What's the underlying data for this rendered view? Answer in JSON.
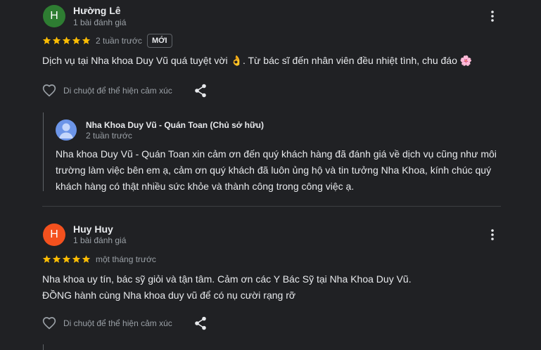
{
  "reviews": [
    {
      "avatar_letter": "H",
      "avatar_color": "#2e7d32",
      "name": "Hường Lê",
      "meta": "1 bài đánh giá",
      "rating": 5,
      "time": "2 tuần trước",
      "badge": "MỚI",
      "text": "Dịch vụ tại Nha khoa Duy Vũ quá tuyệt vời 👌. Từ bác sĩ đến nhân viên đều nhiệt tình, chu đáo 🌸",
      "like_hint": "Di chuột để thể hiện cảm xúc",
      "icons": [
        "more-vert-icon",
        "heart-outline-icon",
        "share-icon"
      ],
      "reply": {
        "owner_name": "Nha Khoa Duy Vũ - Quán Toan (Chủ sở hữu)",
        "time": "2 tuần trước",
        "lines": [
          "Nha khoa Duy Vũ - Quán Toan xin cảm ơn đến quý khách hàng đã đánh giá về dịch vụ cũng như môi",
          "trường làm việc bên em ạ, cảm ơn quý khách đã luôn ủng hộ và tin tưởng Nha Khoa, kính chúc quý",
          "khách hàng có thật nhiều sức khỏe và thành công trong công việc ạ."
        ]
      }
    },
    {
      "avatar_letter": "H",
      "avatar_color": "#f4511e",
      "name": "Huy Huy",
      "meta": "1 bài đánh giá",
      "rating": 5,
      "time": "một tháng trước",
      "lines": [
        "Nha khoa uy tín, bác sỹ giỏi và tận tâm. Cảm ơn các Y Bác Sỹ tại Nha Khoa Duy Vũ.",
        "ĐỒNG hành cùng Nha khoa duy vũ để có nụ cười rạng rỡ"
      ],
      "like_hint": "Di chuột để thể hiện cảm xúc",
      "icons": [
        "more-vert-icon",
        "heart-outline-icon",
        "share-icon"
      ]
    }
  ],
  "colors": {
    "background": "#202124",
    "star": "#fbbc04",
    "text": "#e8eaed",
    "muted": "#9aa0a6",
    "owner_avatar": "#6c95e8"
  }
}
